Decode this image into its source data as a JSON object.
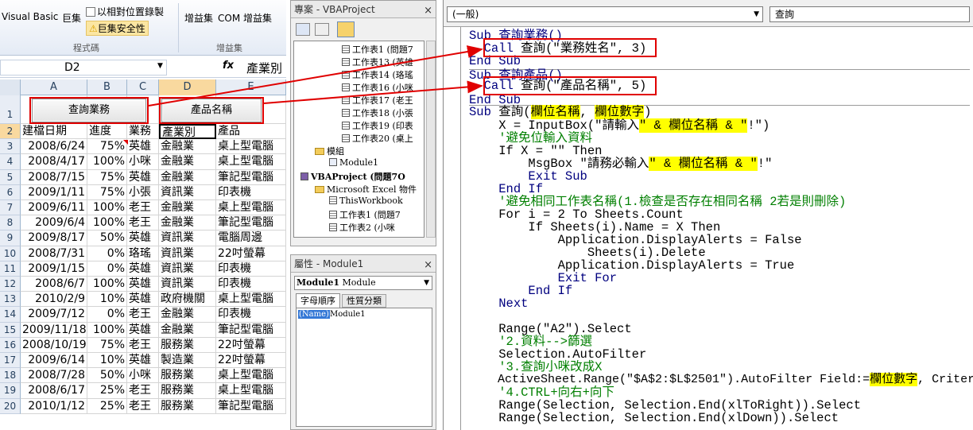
{
  "excel": {
    "ribbon": {
      "visual_basic": "Visual Basic",
      "macros": "巨集",
      "relative_record": "以相對位置錄製",
      "macro_security": "巨集安全性",
      "group_code": "程式碼",
      "addins": "增益集",
      "com_addins": "COM 增益集",
      "group_addins": "增益集"
    },
    "name_box": "D2",
    "formula_value": "產業別",
    "columns": [
      "A",
      "B",
      "C",
      "D",
      "E"
    ],
    "buttons": {
      "query_sales": "查詢業務",
      "product_name": "產品名稱"
    },
    "header_row": [
      "建檔日期",
      "進度",
      "業務",
      "產業別",
      "產品"
    ],
    "rows": [
      [
        "2008/6/24",
        "75%",
        "英雄",
        "金融業",
        "桌上型電腦"
      ],
      [
        "2008/4/17",
        "100%",
        "小咪",
        "金融業",
        "桌上型電腦"
      ],
      [
        "2008/7/15",
        "75%",
        "英雄",
        "金融業",
        "筆記型電腦"
      ],
      [
        "2009/1/11",
        "75%",
        "小張",
        "資訊業",
        "印表機"
      ],
      [
        "2009/6/11",
        "100%",
        "老王",
        "金融業",
        "桌上型電腦"
      ],
      [
        "2009/6/4",
        "100%",
        "老王",
        "金融業",
        "筆記型電腦"
      ],
      [
        "2009/8/17",
        "50%",
        "英雄",
        "資訊業",
        "電腦周邊"
      ],
      [
        "2008/7/31",
        "0%",
        "珞瑤",
        "資訊業",
        "22吋螢幕"
      ],
      [
        "2009/1/15",
        "0%",
        "英雄",
        "資訊業",
        "印表機"
      ],
      [
        "2008/6/7",
        "100%",
        "英雄",
        "資訊業",
        "印表機"
      ],
      [
        "2010/2/9",
        "10%",
        "英雄",
        "政府機關",
        "桌上型電腦"
      ],
      [
        "2009/7/12",
        "0%",
        "老王",
        "金融業",
        "印表機"
      ],
      [
        "2009/11/18",
        "100%",
        "英雄",
        "金融業",
        "筆記型電腦"
      ],
      [
        "2008/10/19",
        "75%",
        "老王",
        "服務業",
        "22吋螢幕"
      ],
      [
        "2009/6/14",
        "10%",
        "英雄",
        "製造業",
        "22吋螢幕"
      ],
      [
        "2008/7/28",
        "50%",
        "小咪",
        "服務業",
        "桌上型電腦"
      ],
      [
        "2008/6/17",
        "25%",
        "老王",
        "服務業",
        "桌上型電腦"
      ],
      [
        "2010/1/12",
        "25%",
        "老王",
        "服務業",
        "筆記型電腦"
      ]
    ],
    "row_numbers": [
      "1",
      "2",
      "3",
      "4",
      "5",
      "6",
      "7",
      "8",
      "9",
      "10",
      "11",
      "12",
      "13",
      "14",
      "15",
      "16",
      "17",
      "18",
      "19",
      "20"
    ]
  },
  "project": {
    "title": "專案 - VBAProject",
    "close": "×",
    "tree": [
      {
        "label": "工作表1 (問題7",
        "type": "sheet"
      },
      {
        "label": "工作表13 (英雄",
        "type": "sheet"
      },
      {
        "label": "工作表14 (珞瑤",
        "type": "sheet"
      },
      {
        "label": "工作表16 (小咪",
        "type": "sheet"
      },
      {
        "label": "工作表17 (老王",
        "type": "sheet"
      },
      {
        "label": "工作表18 (小張",
        "type": "sheet"
      },
      {
        "label": "工作表19 (印表",
        "type": "sheet"
      },
      {
        "label": "工作表20 (桌上",
        "type": "sheet"
      },
      {
        "label": "模組",
        "type": "folder"
      },
      {
        "label": "Module1",
        "type": "module"
      },
      {
        "label": "VBAProject (問題7O",
        "type": "project"
      },
      {
        "label": "Microsoft Excel 物件",
        "type": "folder"
      },
      {
        "label": "ThisWorkbook",
        "type": "sheet"
      },
      {
        "label": "工作表1 (問題7",
        "type": "sheet"
      },
      {
        "label": "工作表2 (小咪",
        "type": "sheet"
      }
    ]
  },
  "properties": {
    "title": "屬性 - Module1",
    "close": "×",
    "object_name": "Module1",
    "object_type": "Module",
    "tab_alpha": "字母順序",
    "tab_category": "性質分類",
    "prop_name": "(Name)",
    "prop_value": "Module1"
  },
  "code": {
    "object_combo": "(一般)",
    "proc_combo": "查詢",
    "lines": {
      "l1": "Sub 查詢業務()",
      "l2a": "Call",
      "l2b": " 查詢(\"業務姓名\", 3)",
      "l3": "End Sub",
      "l4": "Sub 查詢產品()",
      "l5a": "Call",
      "l5b": " 查詢(\"產品名稱\", 5)",
      "l6": "End Sub",
      "l7a": "Sub",
      "l7b": " 查詢(",
      "l7c": "欄位名稱",
      "l7d": ", ",
      "l7e": "欄位數字",
      "l7f": ")",
      "l8a": "X = InputBox(\"請輸入",
      "l8b": "\" & 欄位名稱 & \"",
      "l8c": "!\")",
      "l9": "'避免位輸入資料",
      "l10": "If X = \"\" Then",
      "l11a": "MsgBox \"請務必輸入",
      "l11b": "\" & 欄位名稱 & \"",
      "l11c": "!\"",
      "l12": "Exit Sub",
      "l13": "End If",
      "l14": "'避免相同工作表名稱(1.檢查是否存在相同名稱 2若是則刪除)",
      "l15": "For i = 2 To Sheets.Count",
      "l16": "If Sheets(i).Name = X Then",
      "l17": "Application.DisplayAlerts = False",
      "l18": "Sheets(i).Delete",
      "l19": "Application.DisplayAlerts = True",
      "l20": "Exit For",
      "l21": "End If",
      "l22": "Next",
      "l23": "Range(\"A2\").Select",
      "l24": "'2.資料-->篩選",
      "l25": "Selection.AutoFilter",
      "l26": "'3.查詢小咪改成X",
      "l27a": "ActiveSheet.Range(\"$A$2:$L$2501\").AutoFilter Field:=",
      "l27b": "欄位數字",
      "l27c": ", Criterial:=X",
      "l28": "'4.CTRL+向右+向下",
      "l29": "Range(Selection, Selection.End(xlToRight)).Select",
      "l30": "Range(Selection, Selection.End(xlDown)).Select"
    }
  },
  "colors": {
    "highlight": "#ffff00",
    "annotation": "#e00000",
    "comment": "#007f00",
    "keyword": "#00007f"
  }
}
